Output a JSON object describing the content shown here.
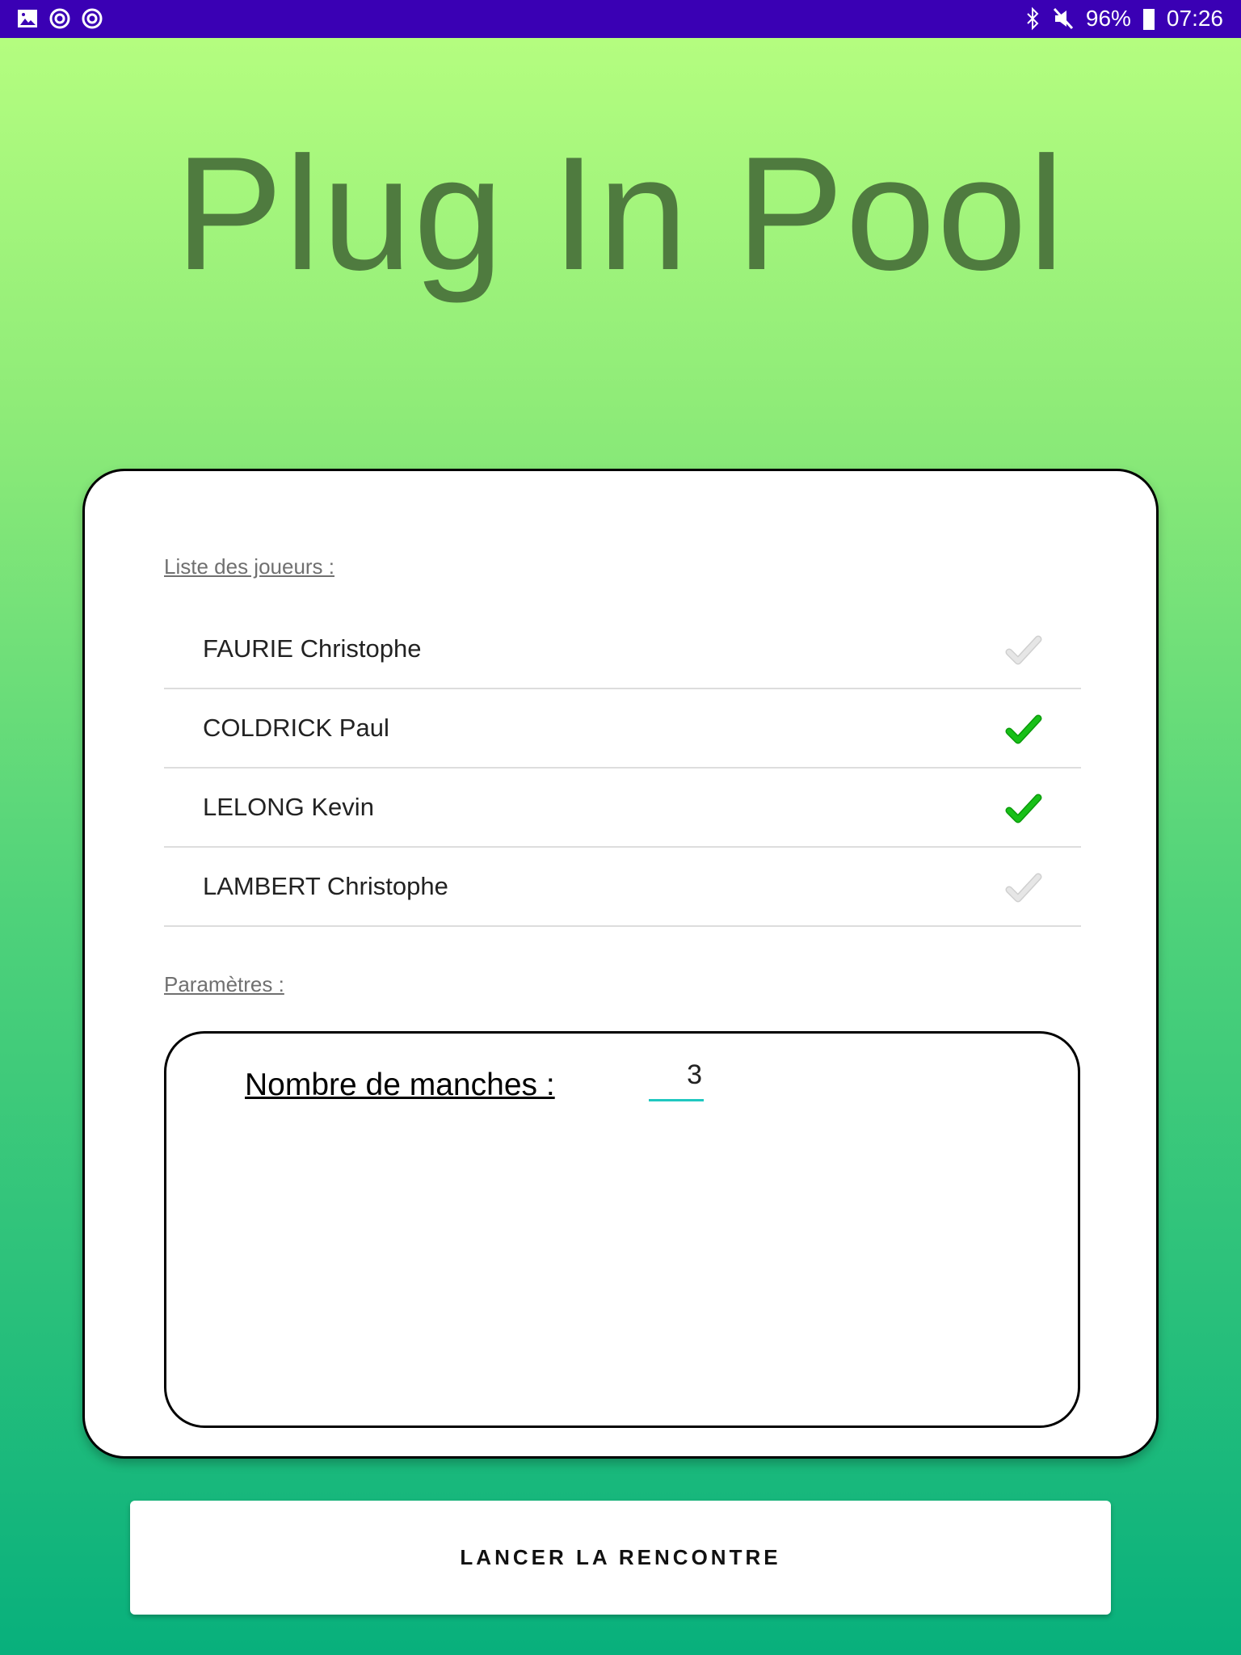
{
  "status_bar": {
    "battery": "96%",
    "time": "07:26",
    "icons": [
      "image-icon",
      "sync-icon",
      "sync-icon",
      "bluetooth-icon",
      "mute-icon",
      "battery-icon"
    ]
  },
  "app": {
    "title": "Plug In Pool"
  },
  "players": {
    "label": "Liste des joueurs :",
    "items": [
      {
        "name": "FAURIE Christophe",
        "selected": false
      },
      {
        "name": "COLDRICK Paul",
        "selected": true
      },
      {
        "name": "LELONG Kevin",
        "selected": true
      },
      {
        "name": "LAMBERT Christophe",
        "selected": false
      }
    ]
  },
  "params": {
    "label": "Paramètres :",
    "rounds_label": "Nombre de manches :",
    "rounds_value": "3"
  },
  "colors": {
    "check_on": "#18c018",
    "check_off": "#e6e6e6",
    "accent": "#1fc8c0"
  },
  "button": {
    "label": "LANCER LA RENCONTRE"
  }
}
